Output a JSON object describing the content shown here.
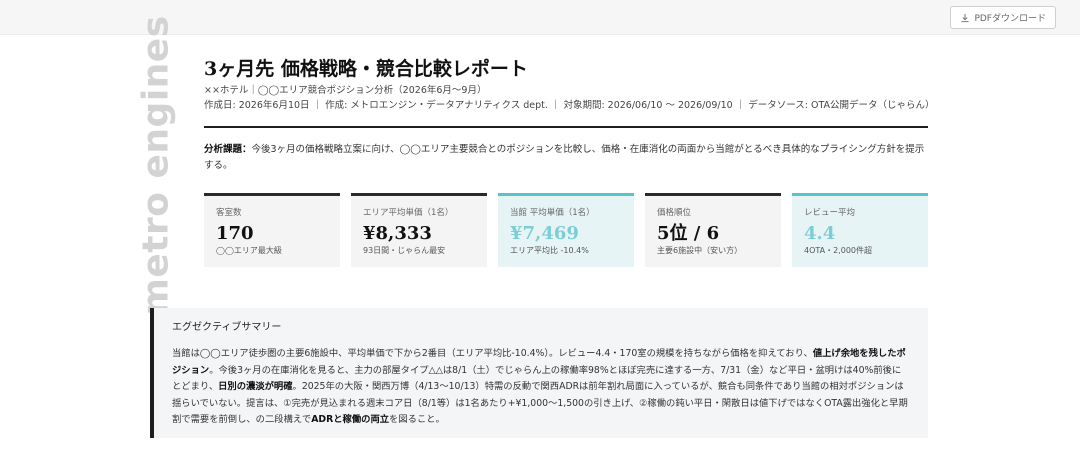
{
  "toolbar": {
    "pdf_download_label": "PDFダウンロード",
    "download_icon": "download-icon"
  },
  "brand": {
    "logo_text": "metro engines"
  },
  "report": {
    "title": "3ヶ月先 価格戦略・競合比較レポート",
    "subtitle": "××ホテル｜◯◯エリア競合ポジション分析（2026年6月〜9月）",
    "meta": "作成日: 2026年6月10日 ｜ 作成: メトロエンジン・データアナリティクス dept. ｜ 対象期間: 2026/06/10 〜 2026/09/10 ｜ データソース: OTA公開データ（じゃらん）"
  },
  "task": {
    "label": "分析課題：",
    "text": "今後3ヶ月の価格戦略立案に向け、◯◯エリア主要競合とのポジションを比較し、価格・在庫消化の両面から当館がとるべき具体的なプライシング方針を提示する。"
  },
  "kpis": [
    {
      "label": "客室数",
      "value": "170",
      "note": "◯◯エリア最大級",
      "accent": "#2a2a2a"
    },
    {
      "label": "エリア平均単価（1名）",
      "value": "¥8,333",
      "note": "93日間・じゃらん最安",
      "accent": "#2a2a2a"
    },
    {
      "label": "当館 平均単価（1名）",
      "value": "¥7,469",
      "note": "エリア平均比 -10.4%",
      "accent": "#58c2cd"
    },
    {
      "label": "価格順位",
      "value": "5位 / 6",
      "note": "主要6施設中（安い方）",
      "accent": "#2a2a2a"
    },
    {
      "label": "レビュー平均",
      "value": "4.4",
      "note": "4OTA・2,000件超",
      "accent": "#58c2cd"
    }
  ],
  "summary": {
    "heading": "エグゼクティブサマリー",
    "p1": "当館は◯◯エリア徒歩圏の主要6施設中、平均単価で下から2番目（エリア平均比-10.4%）。レビュー4.4・170室の規模を持ちながら価格を抑えており、",
    "b1": "値上げ余地を残したポジション",
    "p2": "。今後3ヶ月の在庫消化を見ると、主力の部屋タイプ△△は8/1（土）でじゃらん上の稼働率98%とほぼ完売に達する一方、7/31（金）など平日・盆明けは40%前後にとどまり、",
    "b2": "日別の濃淡が明確",
    "p3": "。2025年の大阪・関西万博（4/13〜10/13）特需の反動で関西ADRは前年割れ局面に入っているが、競合も同条件であり当館の相対ポジションは揺らいでいない。提言は、①完売が見込まれる週末コア日（8/1等）は1名あたり+¥1,000〜1,500の引き上げ、②稼働の鈍い平日・閑散日は値下げではなくOTA露出強化と早期割で需要を前倒し、の二段構えで",
    "b3": "ADRと稼働の両立",
    "p4": "を図ること。"
  }
}
